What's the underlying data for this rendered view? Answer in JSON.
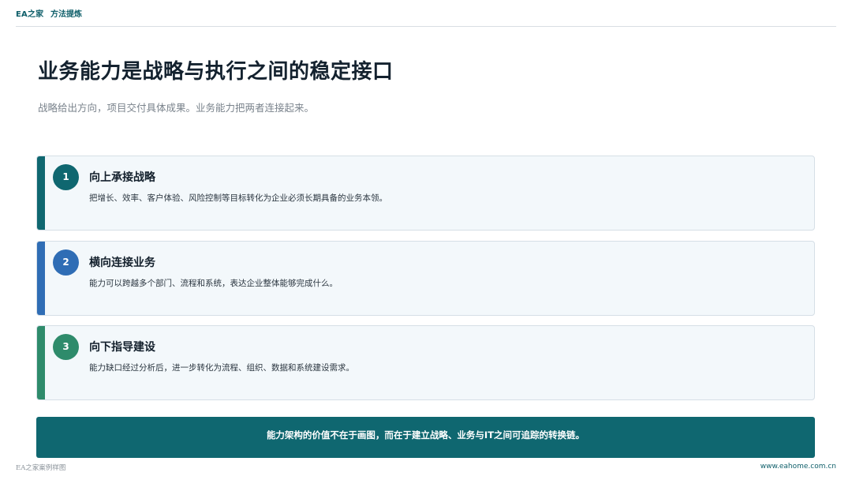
{
  "header": {
    "brand": "EA之家",
    "section": "方法提炼"
  },
  "slide": {
    "title": "业务能力是战略与执行之间的稳定接口",
    "subtitle": "战略给出方向，项目交付具体成果。业务能力把两者连接起来。"
  },
  "cards": [
    {
      "number": "1",
      "title": "向上承接战略",
      "description": "把增长、效率、客户体验、风险控制等目标转化为企业必须长期具备的业务本领。",
      "accent": "#0f6770"
    },
    {
      "number": "2",
      "title": "横向连接业务",
      "description": "能力可以跨越多个部门、流程和系统，表达企业整体能够完成什么。",
      "accent": "#2f6db5"
    },
    {
      "number": "3",
      "title": "向下指导建设",
      "description": "能力缺口经过分析后，进一步转化为流程、组织、数据和系统建设需求。",
      "accent": "#2e8b6b"
    }
  ],
  "banner": {
    "text": "能力架构的价值不在于画图，而在于建立战略、业务与IT之间可追踪的转换链。"
  },
  "footer": {
    "left": "EA之家案例样图",
    "right": "www.eahome.com.cn"
  }
}
